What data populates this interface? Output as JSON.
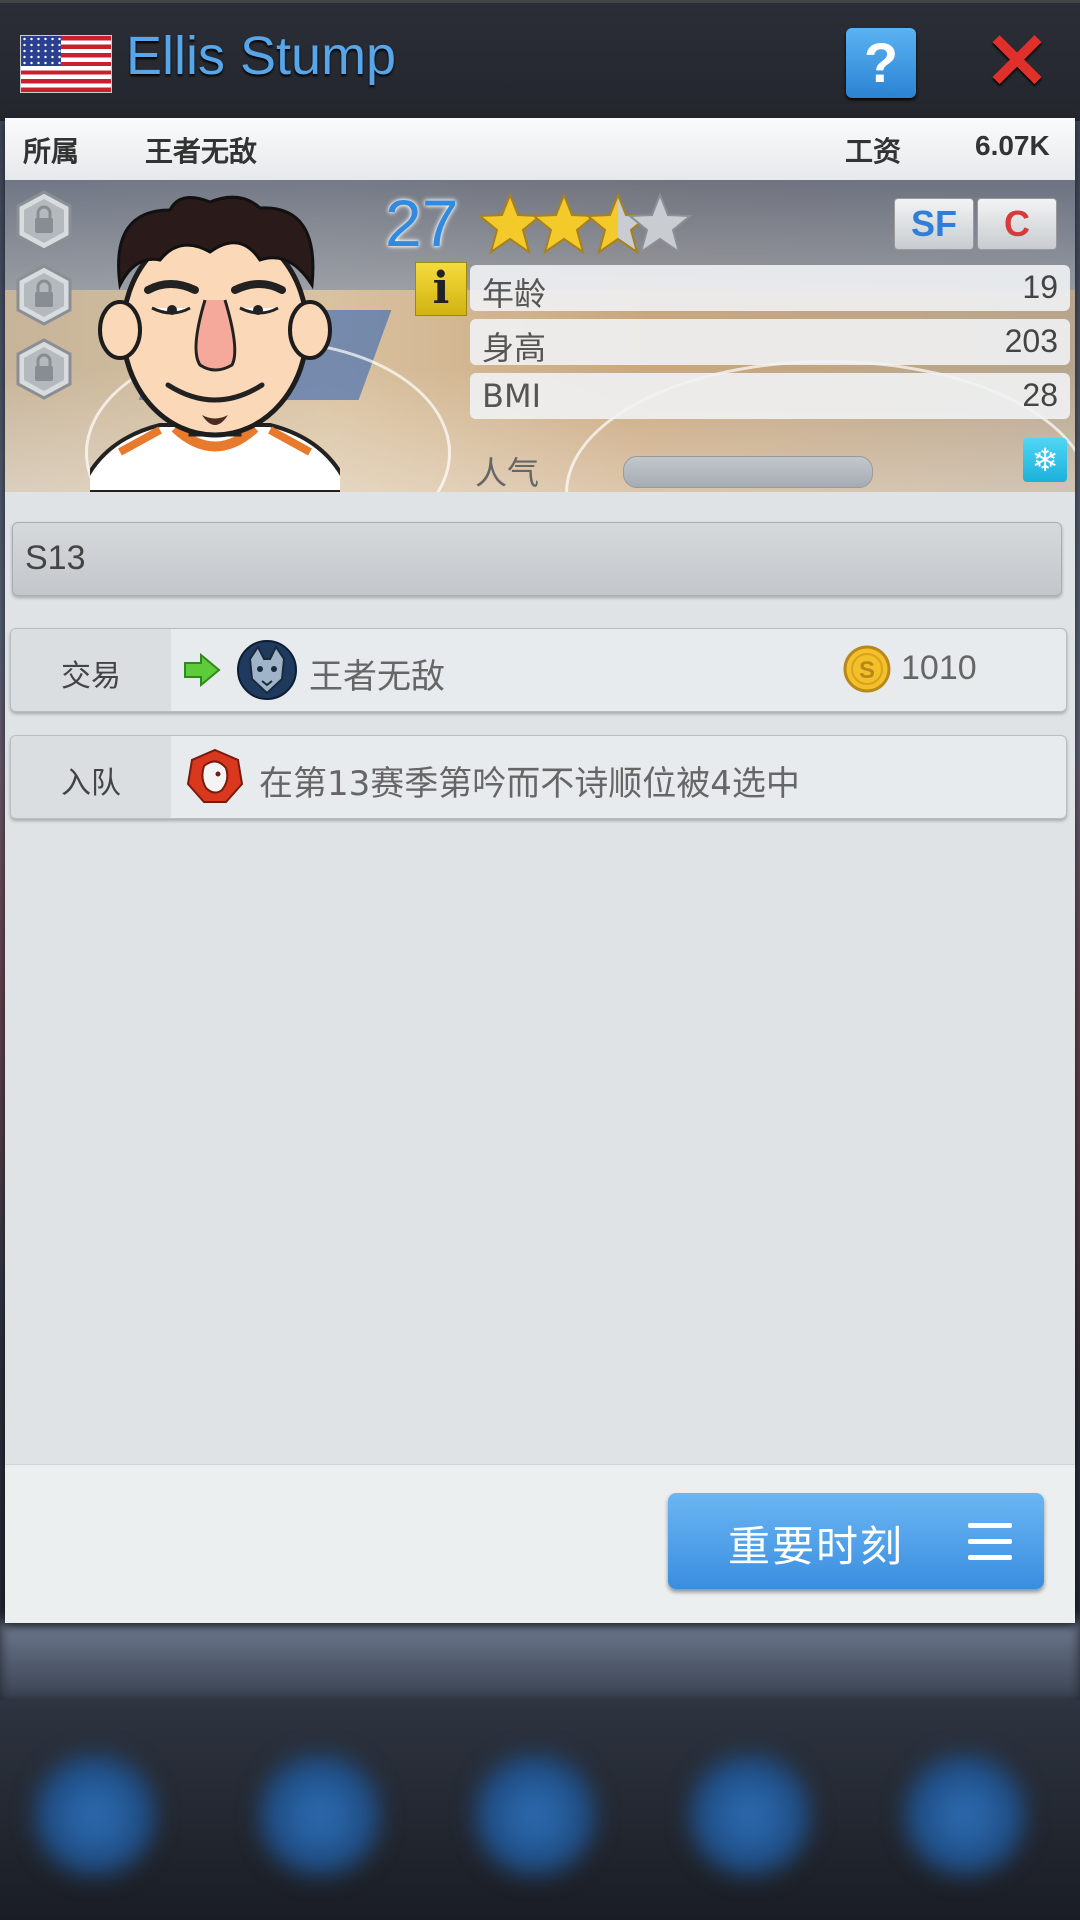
{
  "header": {
    "player_name": "Ellis Stump",
    "help_label": "?",
    "close_label": "✕"
  },
  "infobar": {
    "team_label": "所属",
    "team_value": "王者无敌",
    "salary_label": "工资",
    "salary_value": "6.07K"
  },
  "hero": {
    "rating": "27",
    "stars_filled": 3,
    "stars_total": 4,
    "positions": [
      {
        "label": "SF",
        "color": "#2f7fd8"
      },
      {
        "label": "C",
        "color": "#d63a3a"
      }
    ],
    "info_icon": "i",
    "stats": [
      {
        "label": "年龄",
        "value": "19"
      },
      {
        "label": "身高",
        "value": "203"
      },
      {
        "label": "BMI",
        "value": "28"
      }
    ],
    "popularity_label": "人气",
    "popularity_fraction": 0.0,
    "snow_icon": "❄"
  },
  "season": {
    "label": "S13"
  },
  "history": [
    {
      "label": "交易",
      "text": "王者无敌",
      "coin_value": "1010",
      "icon": "wolf-team-logo-icon"
    },
    {
      "label": "入队",
      "text": "在第13赛季第吟而不诗顺位被4选中",
      "icon": "lion-team-logo-icon"
    }
  ],
  "footer": {
    "moments_label": "重要时刻"
  },
  "colors": {
    "accent_blue": "#57a6ea",
    "close_red": "#e0302c",
    "rating_blue": "#2f8ae0",
    "button_blue": "#3a8ee0"
  }
}
